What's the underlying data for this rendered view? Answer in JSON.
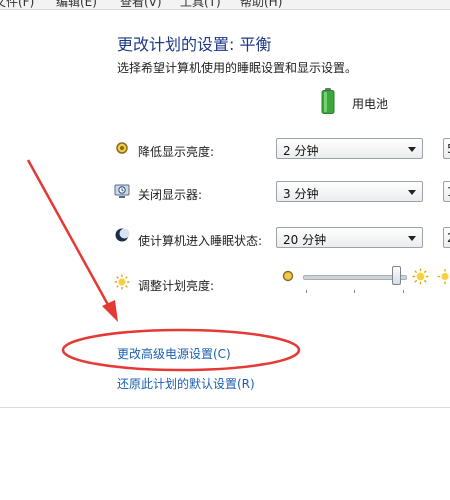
{
  "menu": [
    "文件(F)",
    "编辑(E)",
    "查看(V)",
    "工具(T)",
    "帮助(H)"
  ],
  "header": {
    "title": "更改计划的设置: 平衡",
    "subtitle": "选择希望计算机使用的睡眠设置和显示设置。"
  },
  "column": {
    "battery_label": "用电池"
  },
  "settings": {
    "dim_display": {
      "label": "降低显示亮度:",
      "battery_value": "2 分钟",
      "partial_value": "5"
    },
    "turn_off_display": {
      "label": "关闭显示器:",
      "battery_value": "3 分钟",
      "partial_value": "1"
    },
    "sleep": {
      "label": "使计算机进入睡眠状态:",
      "battery_value": "20 分钟",
      "partial_value": "2"
    },
    "brightness": {
      "label": "调整计划亮度:",
      "level_fraction": 0.92
    }
  },
  "links": {
    "advanced": "更改高级电源设置(C)",
    "restore": "还原此计划的默认设置(R)"
  },
  "annotation_color": "#e53935"
}
